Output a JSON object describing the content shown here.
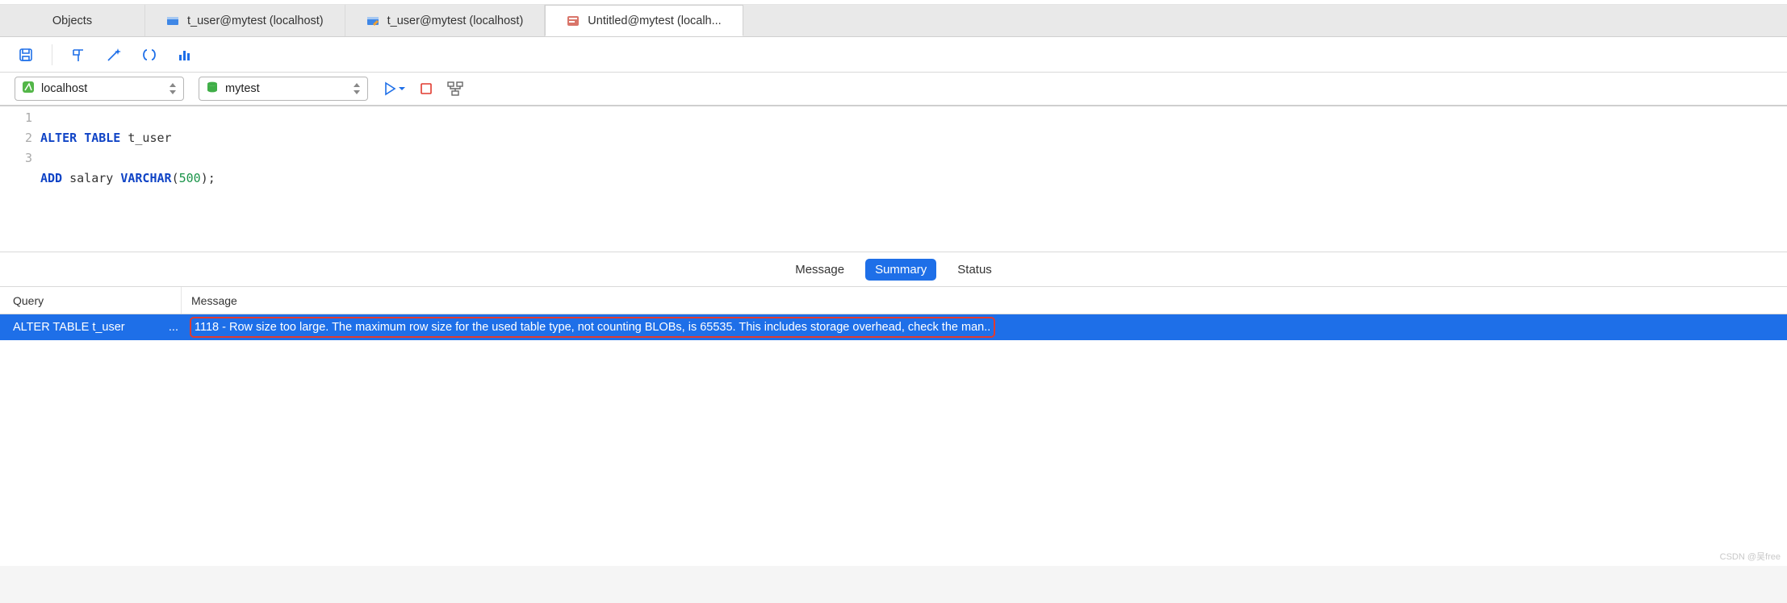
{
  "tabs": {
    "objects": "Objects",
    "t1": "t_user@mytest (localhost)",
    "t2": "t_user@mytest (localhost)",
    "t3": "Untitled@mytest (localh..."
  },
  "connection": {
    "host": "localhost",
    "database": "mytest"
  },
  "sql": {
    "line1_kw1": "ALTER",
    "line1_kw2": "TABLE",
    "line1_ident": "t_user",
    "line2_kw1": "ADD",
    "line2_ident": "salary",
    "line2_type": "VARCHAR",
    "line2_open": "(",
    "line2_num": "500",
    "line2_close": ");"
  },
  "gutter": {
    "l1": "1",
    "l2": "2",
    "l3": "3"
  },
  "result_tabs": {
    "message": "Message",
    "summary": "Summary",
    "status": "Status"
  },
  "result_header": {
    "query": "Query",
    "message": "Message"
  },
  "result_row": {
    "query": "ALTER TABLE t_user",
    "ellipsis": "...",
    "message": "1118 - Row size too large. The maximum row size for the used table type, not counting BLOBs, is 65535. This includes storage overhead, check the man.."
  },
  "watermark": "CSDN @吴free"
}
